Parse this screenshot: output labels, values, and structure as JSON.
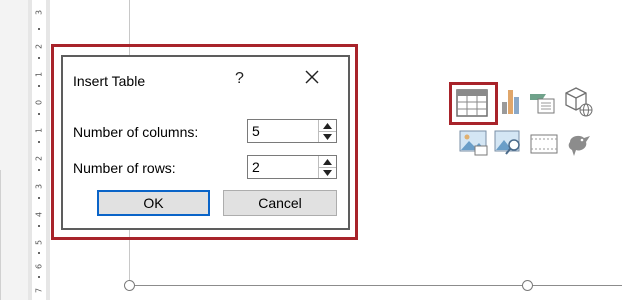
{
  "ruler": {
    "labels": [
      "3",
      "2",
      "1",
      "0",
      "1",
      "2",
      "3",
      "4",
      "5",
      "6",
      "7"
    ]
  },
  "dialog": {
    "title": "Insert Table",
    "help": "?",
    "columns_label": "Number of columns:",
    "columns_value": "5",
    "rows_label": "Number of rows:",
    "rows_value": "2",
    "ok_label": "OK",
    "cancel_label": "Cancel"
  },
  "icons": [
    "table-icon",
    "chart-icon",
    "smartart-icon",
    "3d-model-icon",
    "picture-icon",
    "online-picture-icon",
    "video-icon",
    "icons-icon"
  ],
  "colors": {
    "highlight": "#a8232a",
    "ok_border": "#0a64c8"
  }
}
